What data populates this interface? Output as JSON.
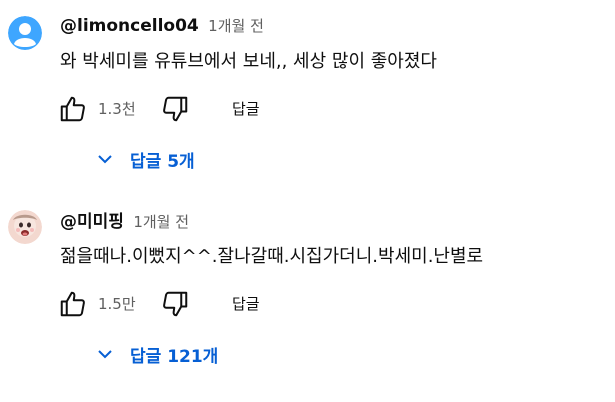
{
  "comments": [
    {
      "author": "@limoncello04",
      "time": "1개월 전",
      "text": "와 박세미를 유튜브에서 보네,, 세상 많이 좋아졌다",
      "likes": "1.3천",
      "reply_label": "답글",
      "replies_label": "답글 5개",
      "avatar_color": "#3ea6ff",
      "avatar_icon": "default-person-avatar"
    },
    {
      "author": "@미미핑",
      "time": "1개월 전",
      "text": "젊을때나.이뻤지^^.잘나갈때.시집가더니.박세미.난별로",
      "likes": "1.5만",
      "reply_label": "답글",
      "replies_label": "답글 121개",
      "avatar_icon": "illustrated-character-avatar"
    }
  ],
  "colors": {
    "link_blue": "#065fd4",
    "secondary_text": "#606060",
    "primary_text": "#0f0f0f"
  }
}
